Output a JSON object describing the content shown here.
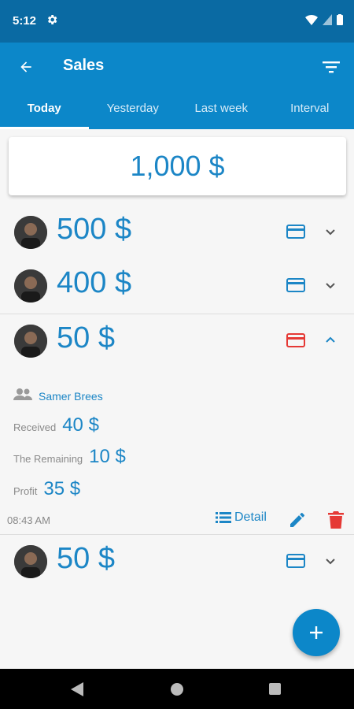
{
  "status": {
    "time": "5:12"
  },
  "app_bar": {
    "title": "Sales"
  },
  "tabs": [
    {
      "label": "Today",
      "active": true
    },
    {
      "label": "Yesterday",
      "active": false
    },
    {
      "label": "Last week",
      "active": false
    },
    {
      "label": "Interval",
      "active": false
    }
  ],
  "total": "1,000 $",
  "sales": [
    {
      "amount": "500 $",
      "card_color": "#1c86c6",
      "expanded": false
    },
    {
      "amount": "400 $",
      "card_color": "#1c86c6",
      "expanded": false
    },
    {
      "amount": "50 $",
      "card_color": "#e53935",
      "expanded": true
    },
    {
      "amount": "50 $",
      "card_color": "#1c86c6",
      "expanded": false
    }
  ],
  "detail": {
    "customer": "Samer Brees",
    "received_label": "Received",
    "received_value": "40 $",
    "remaining_label": "The Remaining",
    "remaining_value": "10 $",
    "profit_label": "Profit",
    "profit_value": "35 $",
    "time": "08:43 AM",
    "detail_label": "Detail"
  },
  "colors": {
    "primary": "#0c87c9",
    "status": "#0a6aa3",
    "accent_text": "#1c86c6",
    "danger": "#e53935"
  }
}
